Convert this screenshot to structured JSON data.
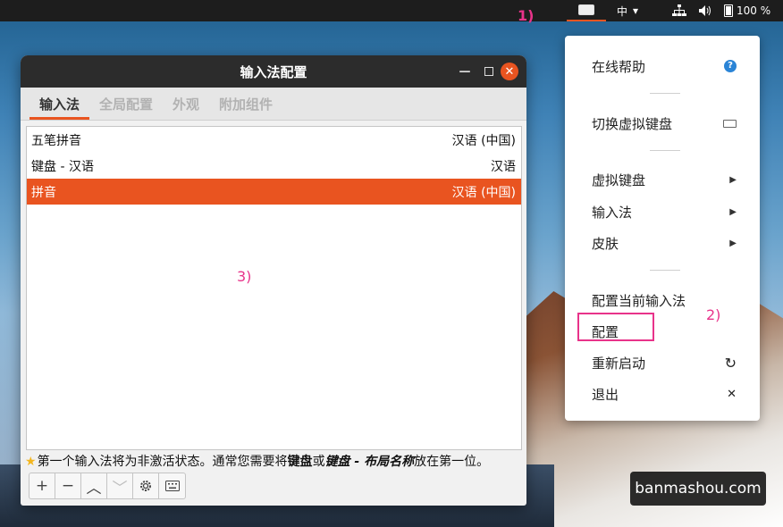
{
  "topbar": {
    "input_lang": "中",
    "lang_chevron": "▾",
    "battery": "100 %",
    "icons": [
      "keyboard-icon",
      "network-icon",
      "volume-icon",
      "battery-icon"
    ]
  },
  "annotations": {
    "a1": "1)",
    "a2": "2)",
    "a3": "3)"
  },
  "window": {
    "title": "输入法配置",
    "tabs": [
      "输入法",
      "全局配置",
      "外观",
      "附加组件"
    ],
    "rows": [
      {
        "name": "五笔拼音",
        "lang": "汉语 (中国)"
      },
      {
        "name": "键盘 - 汉语",
        "lang": "汉语"
      },
      {
        "name": "拼音",
        "lang": "汉语 (中国)",
        "selected": true
      }
    ],
    "hint": {
      "part1": "第一个输入法将为非激活状态。通常您需要将",
      "bold1": "键盘",
      "part2": "或",
      "bold2": "键盘 - 布局名称",
      "part3": "放在第一位。"
    },
    "toolbar": {
      "add": "+",
      "remove": "−",
      "up": "︿",
      "down": "﹀"
    }
  },
  "menu": {
    "help": "在线帮助",
    "toggle_vkbd": "切换虚拟键盘",
    "vkbd": "虚拟键盘",
    "input_method": "输入法",
    "skin": "皮肤",
    "config_current": "配置当前输入法",
    "config": "配置",
    "restart": "重新启动",
    "exit": "退出"
  },
  "watermark": "banmashou.com",
  "colors": {
    "accent": "#e95420",
    "annotation": "#e8338a"
  }
}
